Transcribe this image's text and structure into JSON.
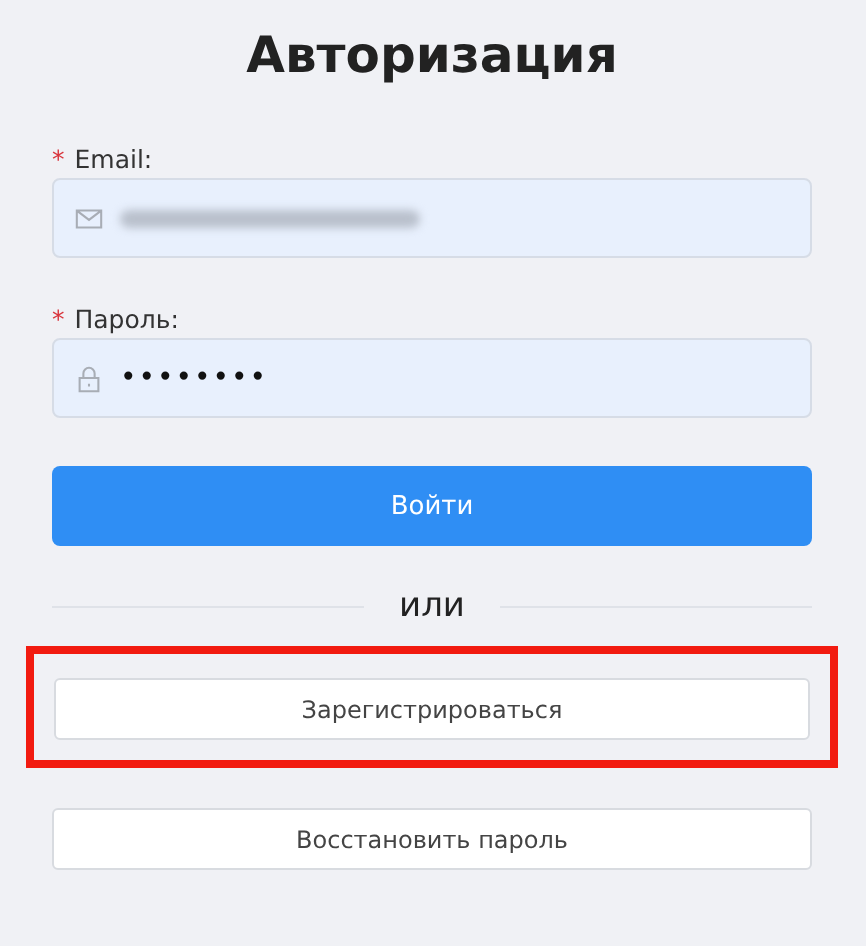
{
  "title": "Авторизация",
  "fields": [
    {
      "kind": "email",
      "label": "Email:",
      "required": true,
      "value_obscured": true
    },
    {
      "kind": "password",
      "label": "Пароль:",
      "required": true,
      "value": "••••••••"
    }
  ],
  "required_mark": "*",
  "submit_button": "Войти",
  "divider_text": "или",
  "secondary_buttons": [
    {
      "label": "Зарегистрироваться",
      "highlighted": true
    },
    {
      "label": "Восстановить пароль",
      "highlighted": false
    }
  ]
}
